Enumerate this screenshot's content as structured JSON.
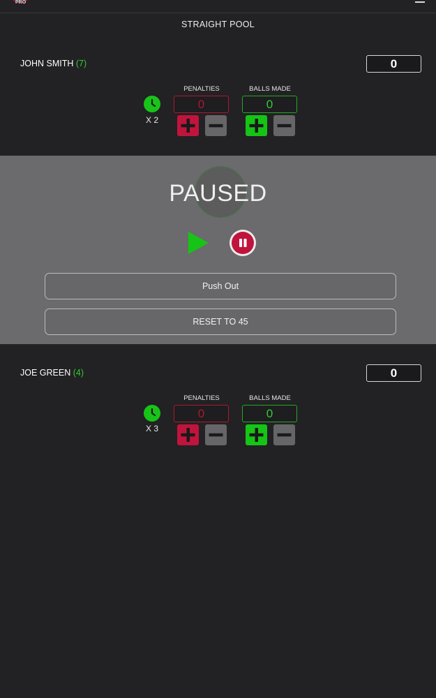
{
  "app": {
    "logo_text": "PRO"
  },
  "header": {
    "title": "STRAIGHT POOL"
  },
  "player1": {
    "name": "JOHN SMITH",
    "rack": "(7)",
    "score": "0",
    "extension_label": "X 2",
    "penalties_label": "PENALTIES",
    "penalties_value": "0",
    "balls_label": "BALLS MADE",
    "balls_value": "0"
  },
  "pause": {
    "status": "PAUSED",
    "push_out_label": "Push Out",
    "reset_label": "RESET TO 45"
  },
  "player2": {
    "name": "JOE GREEN",
    "rack": "(4)",
    "score": "0",
    "extension_label": "X 3",
    "penalties_label": "PENALTIES",
    "penalties_value": "0",
    "balls_label": "BALLS MADE",
    "balls_value": "0"
  },
  "colors": {
    "background": "#222124",
    "pause_panel": "#6b6a6c",
    "accent_green": "#16c416",
    "accent_red": "#c0143c",
    "neutral_button": "#666568"
  },
  "icons": {
    "logo": "logo-icon",
    "menu": "hamburger-menu-icon",
    "clock": "clock-icon",
    "plus": "plus-icon",
    "minus": "minus-icon",
    "play": "play-icon",
    "pause": "pause-icon"
  }
}
